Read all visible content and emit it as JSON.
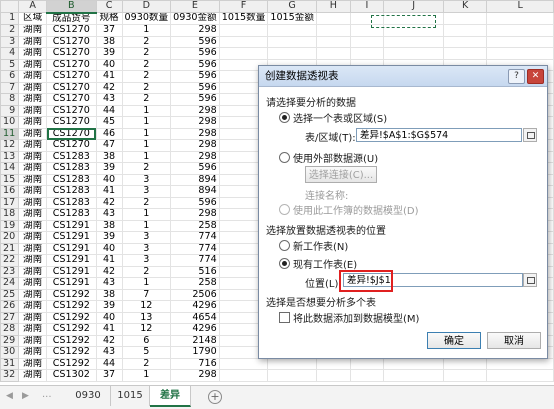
{
  "columns": [
    "A",
    "B",
    "C",
    "D",
    "E",
    "F",
    "G",
    "H",
    "I",
    "J",
    "K",
    "L"
  ],
  "header_row": [
    "区域",
    "成品货号",
    "规格",
    "0930数量",
    "0930金额",
    "1015数量",
    "1015金额",
    "",
    "",
    "",
    "",
    ""
  ],
  "rows": [
    [
      "湖南",
      "CS1270",
      "37",
      "1",
      "298"
    ],
    [
      "湖南",
      "CS1270",
      "38",
      "2",
      "596"
    ],
    [
      "湖南",
      "CS1270",
      "39",
      "2",
      "596"
    ],
    [
      "湖南",
      "CS1270",
      "40",
      "2",
      "596"
    ],
    [
      "湖南",
      "CS1270",
      "41",
      "2",
      "596"
    ],
    [
      "湖南",
      "CS1270",
      "42",
      "2",
      "596"
    ],
    [
      "湖南",
      "CS1270",
      "43",
      "2",
      "596"
    ],
    [
      "湖南",
      "CS1270",
      "44",
      "1",
      "298"
    ],
    [
      "湖南",
      "CS1270",
      "45",
      "1",
      "298"
    ],
    [
      "湖南",
      "CS1270",
      "46",
      "1",
      "298"
    ],
    [
      "湖南",
      "CS1270",
      "47",
      "1",
      "298"
    ],
    [
      "湖南",
      "CS1283",
      "38",
      "1",
      "298"
    ],
    [
      "湖南",
      "CS1283",
      "39",
      "2",
      "596"
    ],
    [
      "湖南",
      "CS1283",
      "40",
      "3",
      "894"
    ],
    [
      "湖南",
      "CS1283",
      "41",
      "3",
      "894"
    ],
    [
      "湖南",
      "CS1283",
      "42",
      "2",
      "596"
    ],
    [
      "湖南",
      "CS1283",
      "43",
      "1",
      "298"
    ],
    [
      "湖南",
      "CS1291",
      "38",
      "1",
      "258"
    ],
    [
      "湖南",
      "CS1291",
      "39",
      "3",
      "774"
    ],
    [
      "湖南",
      "CS1291",
      "40",
      "3",
      "774"
    ],
    [
      "湖南",
      "CS1291",
      "41",
      "3",
      "774"
    ],
    [
      "湖南",
      "CS1291",
      "42",
      "2",
      "516"
    ],
    [
      "湖南",
      "CS1291",
      "43",
      "1",
      "258"
    ],
    [
      "湖南",
      "CS1292",
      "38",
      "7",
      "2506"
    ],
    [
      "湖南",
      "CS1292",
      "39",
      "12",
      "4296"
    ],
    [
      "湖南",
      "CS1292",
      "40",
      "13",
      "4654"
    ],
    [
      "湖南",
      "CS1292",
      "41",
      "12",
      "4296"
    ],
    [
      "湖南",
      "CS1292",
      "42",
      "6",
      "2148"
    ],
    [
      "湖南",
      "CS1292",
      "43",
      "5",
      "1790"
    ],
    [
      "湖南",
      "CS1292",
      "44",
      "2",
      "716"
    ],
    [
      "湖南",
      "CS1302",
      "37",
      "1",
      "298"
    ]
  ],
  "active_cell_row": 10,
  "tabs": {
    "nav_prev": "◀",
    "nav_next": "▶",
    "ellipsis": "...",
    "items": [
      "0930",
      "1015",
      "差异"
    ],
    "active": "差异",
    "add": "+"
  },
  "dialog": {
    "title": "创建数据透视表",
    "help": "?",
    "close": "✕",
    "section1": "请选择要分析的数据",
    "opt_range": "选择一个表或区域(S)",
    "range_label": "表/区域(T):",
    "range_value": "差异!$A$1:$G$574",
    "opt_external": "使用外部数据源(U)",
    "choose_conn": "选择连接(C)...",
    "conn_name": "连接名称:",
    "opt_model": "使用此工作簿的数据模型(D)",
    "section2": "选择放置数据透视表的位置",
    "opt_new": "新工作表(N)",
    "opt_existing": "现有工作表(E)",
    "location_label": "位置(L):",
    "location_value": "差异!$J$1",
    "section3": "选择是否想要分析多个表",
    "add_model": "将此数据添加到数据模型(M)",
    "ok": "确定",
    "cancel": "取消"
  }
}
